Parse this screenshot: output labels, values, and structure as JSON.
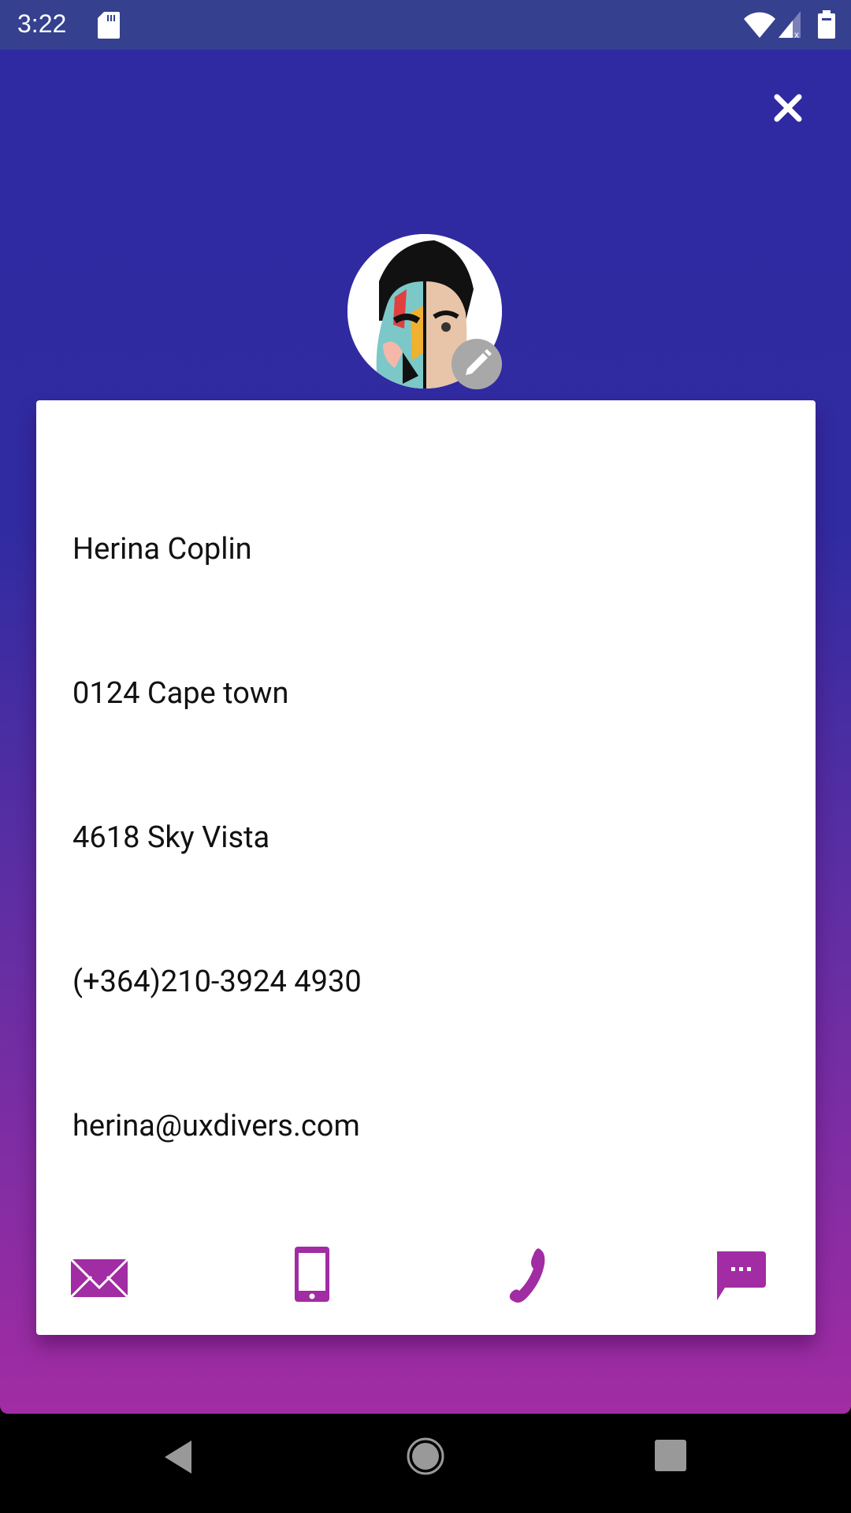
{
  "status_bar": {
    "time": "3:22",
    "icons": [
      "sd-card-icon",
      "wifi-icon",
      "signal-icon",
      "battery-icon"
    ]
  },
  "header": {
    "close_icon": "close-icon"
  },
  "profile": {
    "avatar": "avatar-photo",
    "edit_icon": "pencil-icon"
  },
  "card": {
    "fields": [
      {
        "name": "name",
        "value": "Herina Coplin"
      },
      {
        "name": "address-line-1",
        "value": "0124 Cape town"
      },
      {
        "name": "address-line-2",
        "value": "4618 Sky Vista"
      },
      {
        "name": "phone",
        "value": "(+364)210-3924 4930"
      },
      {
        "name": "email",
        "value": "herina@uxdivers.com"
      }
    ],
    "actions": [
      "email-icon",
      "mobile-icon",
      "phone-icon",
      "message-icon"
    ]
  },
  "colors": {
    "accent": "#a12ca3",
    "status_bar": "#35408f",
    "gradient_top": "#2f2aa1",
    "gradient_bottom": "#a22ca3"
  },
  "nav_bar": [
    "back-icon",
    "home-icon",
    "recents-icon"
  ]
}
